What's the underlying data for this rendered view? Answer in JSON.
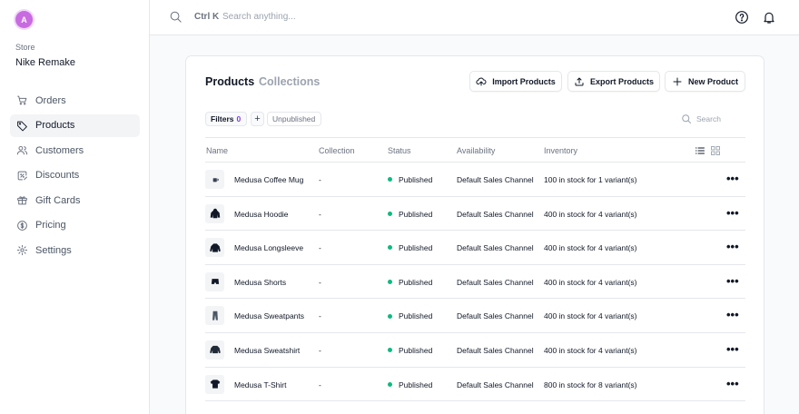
{
  "sidebar": {
    "avatar_initial": "A",
    "store_label": "Store",
    "store_name": "Nike Remake",
    "items": [
      {
        "label": "Orders",
        "icon": "cart-icon"
      },
      {
        "label": "Products",
        "icon": "tag-icon"
      },
      {
        "label": "Customers",
        "icon": "users-icon"
      },
      {
        "label": "Discounts",
        "icon": "receipt-tax-icon"
      },
      {
        "label": "Gift Cards",
        "icon": "gift-icon"
      },
      {
        "label": "Pricing",
        "icon": "currency-dollar-icon"
      },
      {
        "label": "Settings",
        "icon": "cog-icon"
      }
    ],
    "active": "Products"
  },
  "topbar": {
    "shortcut": "Ctrl K",
    "search_placeholder": "Search anything..."
  },
  "main": {
    "tabs": [
      "Products",
      "Collections"
    ],
    "buttons": {
      "import": "Import Products",
      "export": "Export Products",
      "new": "New Product"
    },
    "filters_label": "Filters",
    "filters_count": "0",
    "filter_chip": "Unpublished",
    "table_search_placeholder": "Search",
    "columns": [
      "Name",
      "Collection",
      "Status",
      "Availability",
      "Inventory"
    ],
    "rows": [
      {
        "name": "Medusa Coffee Mug",
        "collection": "-",
        "status": "Published",
        "availability": "Default Sales Channel",
        "inventory": "100 in stock for 1 variant(s)",
        "thumb": "mug"
      },
      {
        "name": "Medusa Hoodie",
        "collection": "-",
        "status": "Published",
        "availability": "Default Sales Channel",
        "inventory": "400 in stock for 4 variant(s)",
        "thumb": "hoodie"
      },
      {
        "name": "Medusa Longsleeve",
        "collection": "-",
        "status": "Published",
        "availability": "Default Sales Channel",
        "inventory": "400 in stock for 4 variant(s)",
        "thumb": "longsleeve"
      },
      {
        "name": "Medusa Shorts",
        "collection": "-",
        "status": "Published",
        "availability": "Default Sales Channel",
        "inventory": "400 in stock for 4 variant(s)",
        "thumb": "shorts"
      },
      {
        "name": "Medusa Sweatpants",
        "collection": "-",
        "status": "Published",
        "availability": "Default Sales Channel",
        "inventory": "400 in stock for 4 variant(s)",
        "thumb": "sweatpants"
      },
      {
        "name": "Medusa Sweatshirt",
        "collection": "-",
        "status": "Published",
        "availability": "Default Sales Channel",
        "inventory": "400 in stock for 4 variant(s)",
        "thumb": "sweatshirt"
      },
      {
        "name": "Medusa T-Shirt",
        "collection": "-",
        "status": "Published",
        "availability": "Default Sales Channel",
        "inventory": "800 in stock for 8 variant(s)",
        "thumb": "tshirt"
      }
    ],
    "row_action": "•••"
  },
  "colors": {
    "accent": "#7c3aed",
    "published": "#10b981",
    "avatar": "#c86be0"
  }
}
